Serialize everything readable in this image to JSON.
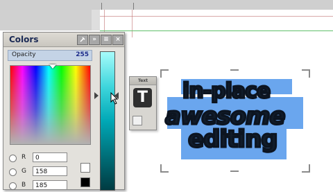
{
  "colors_panel": {
    "title": "Colors",
    "opacity_label": "Opacity",
    "opacity_value": "255",
    "rgb": [
      {
        "label": "R",
        "value": "0"
      },
      {
        "label": "G",
        "value": "158"
      },
      {
        "label": "B",
        "value": "185"
      }
    ],
    "header_buttons": [
      "pin-icon",
      "expand-icon",
      "menu-icon",
      "close-icon"
    ]
  },
  "tool_palette": {
    "title": "Text",
    "tool_glyph": "T"
  },
  "canvas_text": {
    "line1": "in-place",
    "line2": "awesome",
    "line3": "editing"
  },
  "colors": {
    "selected": "#009eb9",
    "highlight": "#6aa6ee",
    "text": "#111c2a"
  }
}
